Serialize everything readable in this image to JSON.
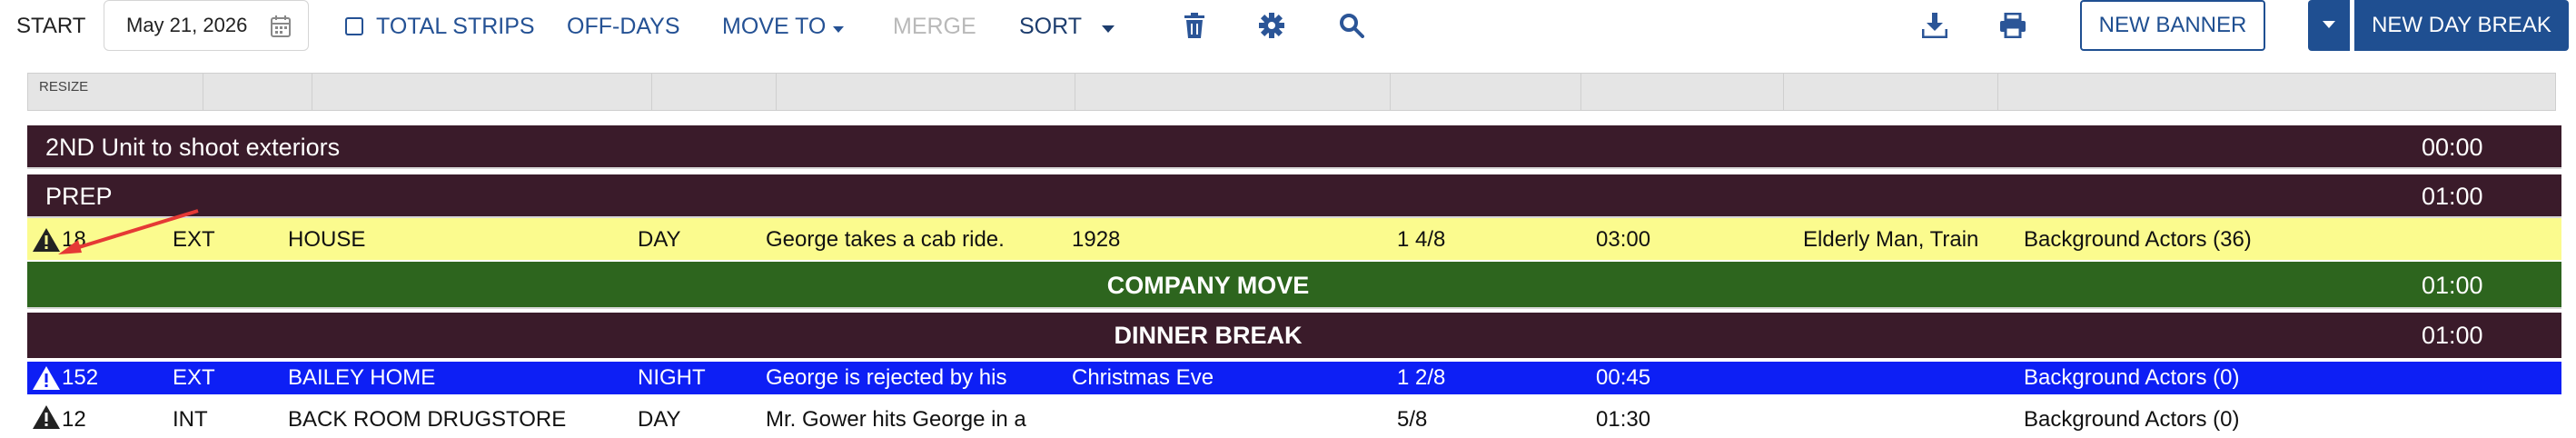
{
  "toolbar": {
    "start_label": "START",
    "date_value": "May 21, 2026",
    "total_strips_label": "TOTAL STRIPS",
    "off_days_label": "OFF-DAYS",
    "move_to_label": "MOVE TO",
    "merge_label": "MERGE",
    "sort_label": "SORT",
    "new_banner_label": "NEW BANNER",
    "new_day_break_label": "NEW DAY BREAK"
  },
  "header": {
    "resize_label": "RESIZE"
  },
  "rows": [
    {
      "type": "banner",
      "text": "2ND Unit to shoot exteriors",
      "time": "00:00",
      "color": "#3a1b2a"
    },
    {
      "type": "banner",
      "text": "PREP",
      "time": "01:00",
      "color": "#3a1b2a"
    },
    {
      "type": "strip",
      "scene": "18",
      "ie": "EXT",
      "set": "HOUSE",
      "dn": "DAY",
      "desc": "George takes a cab ride.",
      "period": "1928",
      "pages": "1 4/8",
      "time": "03:00",
      "cast": "Elderly Man, Train",
      "bg": "Background Actors (36)",
      "color": "#fbfb8e"
    },
    {
      "type": "break",
      "text": "COMPANY MOVE",
      "time": "01:00",
      "color": "#2d651e"
    },
    {
      "type": "break",
      "text": "DINNER BREAK",
      "time": "01:00",
      "color": "#3a1b2a"
    },
    {
      "type": "strip",
      "scene": "152",
      "ie": "EXT",
      "set": "BAILEY HOME",
      "dn": "NIGHT",
      "desc": "George is rejected by his",
      "period": "Christmas Eve",
      "pages": "1 2/8",
      "time": "00:45",
      "cast": "",
      "bg": "Background Actors (0)",
      "color": "#0d1ff5"
    },
    {
      "type": "strip",
      "scene": "12",
      "ie": "INT",
      "set": "BACK ROOM DRUGSTORE",
      "dn": "DAY",
      "desc": "Mr. Gower hits George in a",
      "period": "",
      "pages": "5/8",
      "time": "01:30",
      "cast": "",
      "bg": "Background Actors (0)",
      "color": "#ffffff"
    }
  ],
  "colors": {
    "accent": "#1f4f91",
    "link": "#245194",
    "annotation_arrow": "#e53935"
  },
  "icons": [
    "calendar-icon",
    "checkbox-icon",
    "caret-down-icon",
    "trash-icon",
    "gear-icon",
    "search-icon",
    "download-icon",
    "print-icon",
    "warning-icon"
  ]
}
